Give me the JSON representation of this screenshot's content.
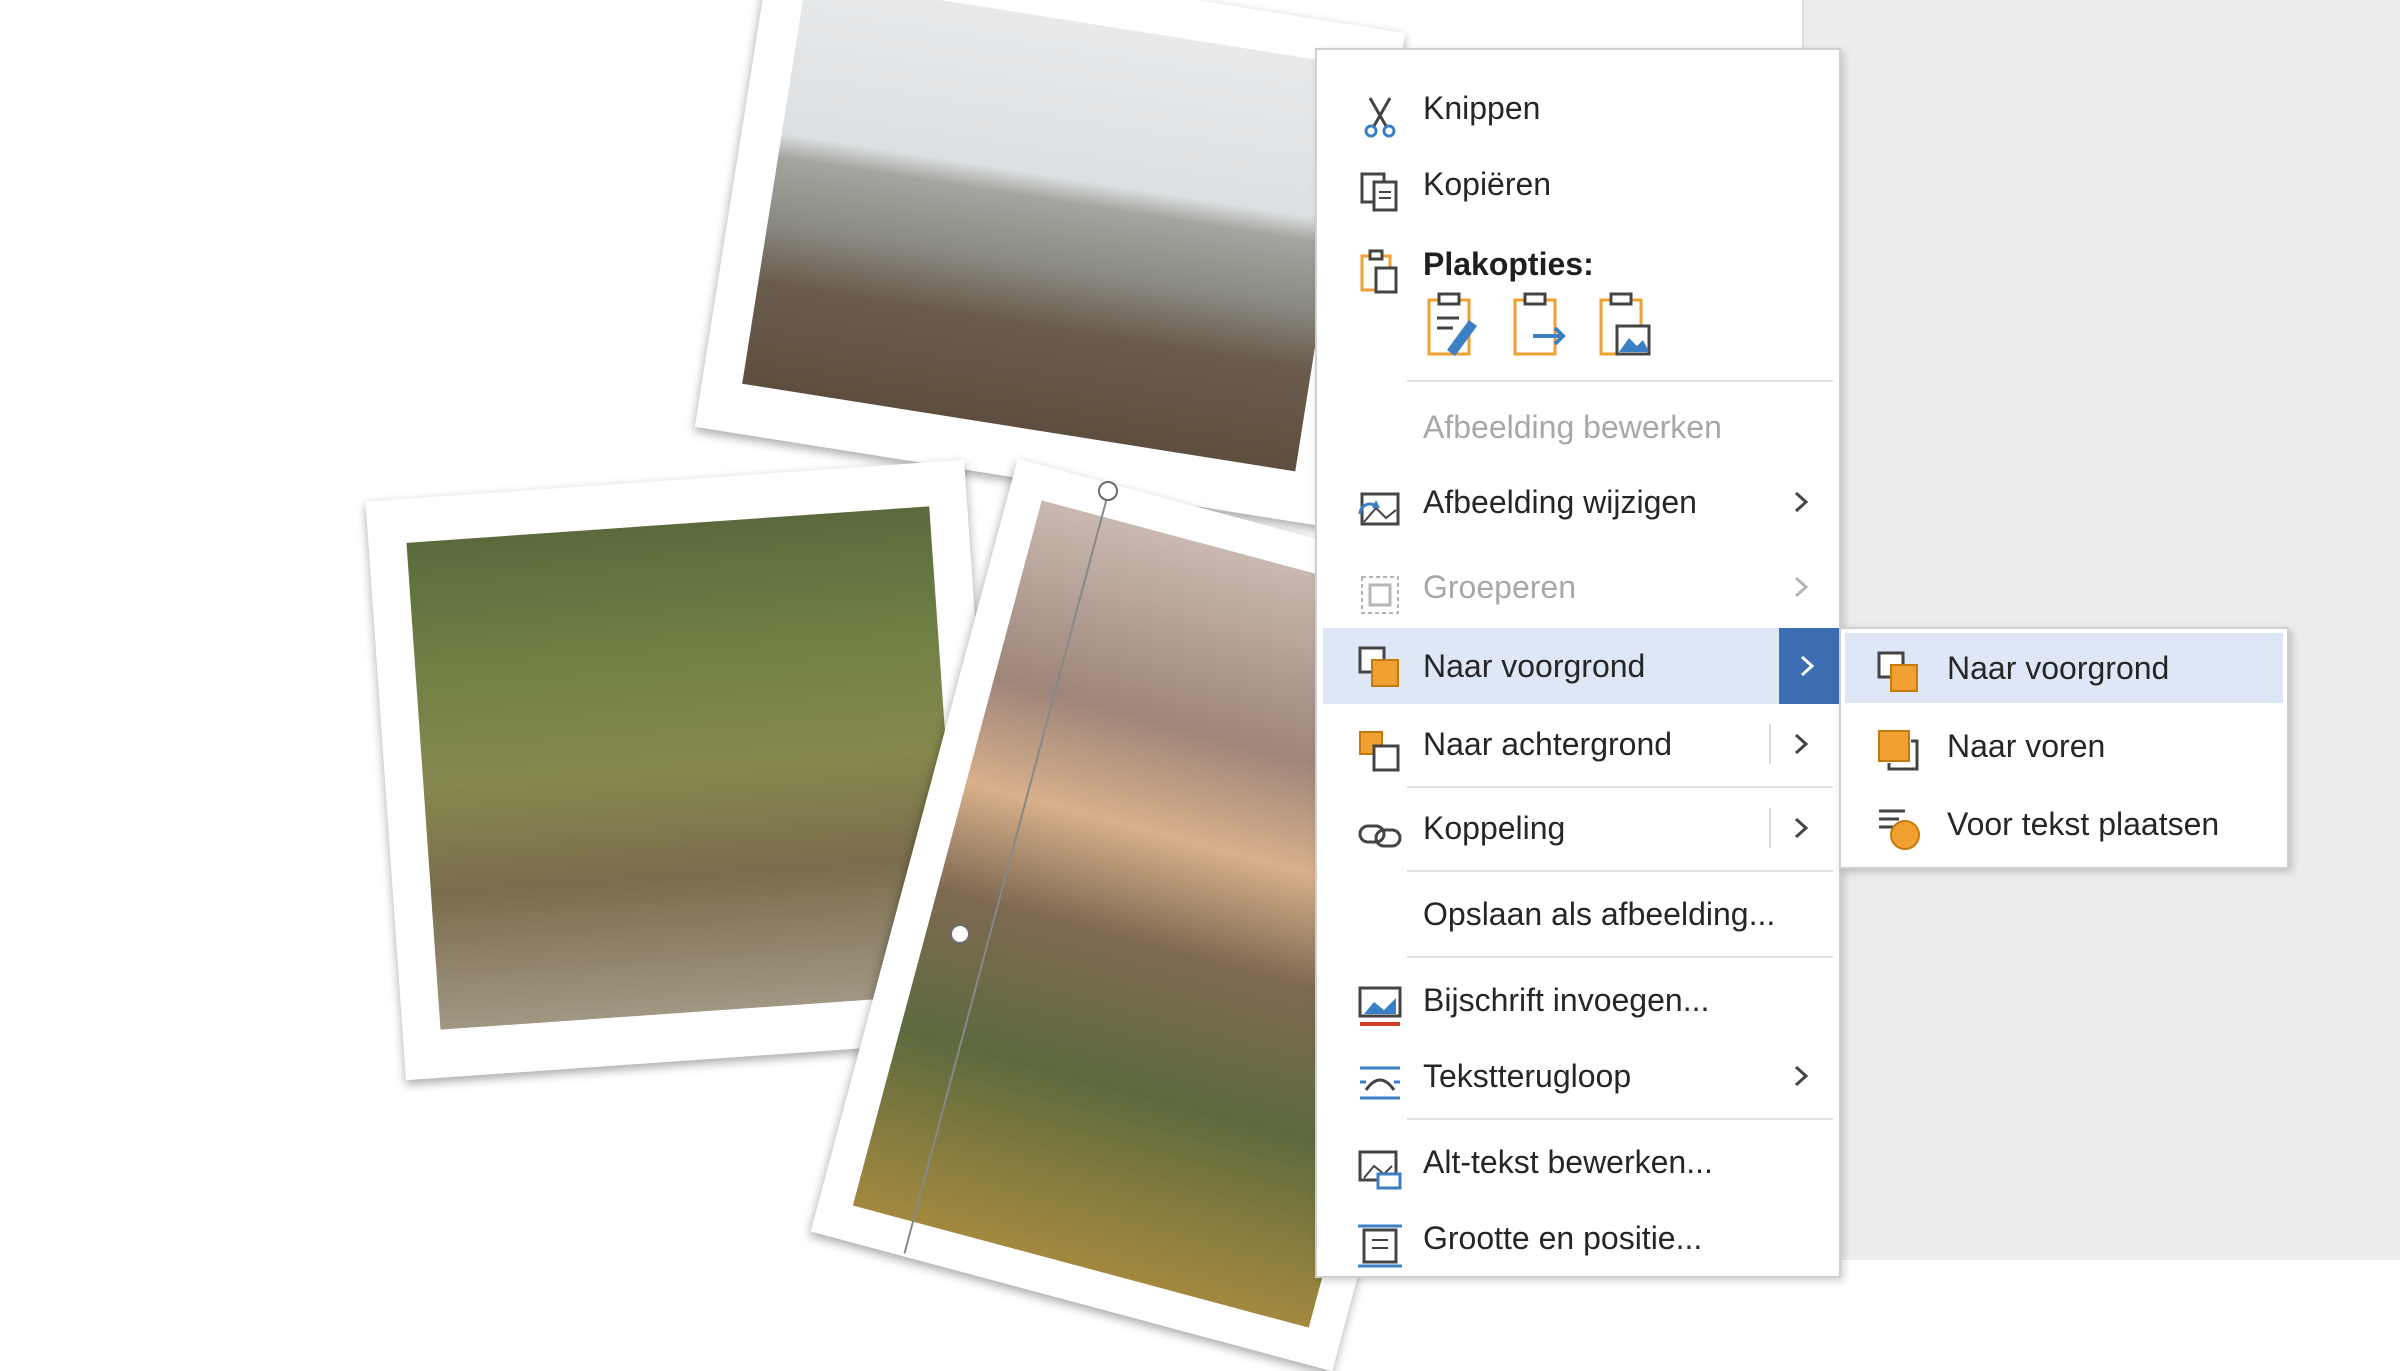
{
  "context_menu": {
    "items": [
      {
        "label": "Knippen",
        "icon": "scissors-icon",
        "enabled": true
      },
      {
        "label": "Kopiëren",
        "icon": "copy-icon",
        "enabled": true
      },
      {
        "label": "Plakopties:",
        "icon": "clipboard-icon",
        "enabled": true
      },
      {
        "label": "Afbeelding bewerken",
        "icon": "",
        "enabled": false
      },
      {
        "label": "Afbeelding wijzigen",
        "icon": "change-picture-icon",
        "enabled": true
      },
      {
        "label": "Groeperen",
        "icon": "group-icon",
        "enabled": false
      },
      {
        "label": "Naar voorgrond",
        "icon": "bring-forward-icon",
        "enabled": true
      },
      {
        "label": "Naar achtergrond",
        "icon": "send-backward-icon",
        "enabled": true
      },
      {
        "label": "Koppeling",
        "icon": "link-icon",
        "enabled": true
      },
      {
        "label": "Opslaan als afbeelding...",
        "icon": "",
        "enabled": true
      },
      {
        "label": "Bijschrift invoegen...",
        "icon": "insert-caption-icon",
        "enabled": true
      },
      {
        "label": "Tekstterugloop",
        "icon": "wrap-text-icon",
        "enabled": true
      },
      {
        "label": "Alt-tekst bewerken...",
        "icon": "alt-text-icon",
        "enabled": true
      },
      {
        "label": "Grootte en positie...",
        "icon": "size-position-icon",
        "enabled": true
      }
    ],
    "paste_options": [
      "paste-keep-formatting-icon",
      "paste-merge-formatting-icon",
      "paste-picture-icon"
    ]
  },
  "submenu": {
    "items": [
      {
        "label": "Naar voorgrond",
        "icon": "bring-to-front-icon"
      },
      {
        "label": "Naar voren",
        "icon": "bring-forward-icon"
      },
      {
        "label": "Voor tekst plaatsen",
        "icon": "in-front-of-text-icon"
      }
    ]
  },
  "colors": {
    "highlight": "#dde7f6",
    "accent": "#3d6db3",
    "icon_orange": "#f0a030",
    "icon_blue": "#3b7fc4"
  }
}
